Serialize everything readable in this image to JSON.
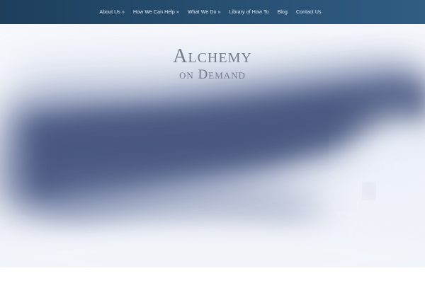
{
  "nav": {
    "items": [
      {
        "label": "About Us »"
      },
      {
        "label": "How We Can Help »"
      },
      {
        "label": "What We Do »"
      },
      {
        "label": "Library of How To"
      },
      {
        "label": "Blog"
      },
      {
        "label": "Contact Us"
      }
    ]
  },
  "hero": {
    "brand_line1": "Alchemy",
    "brand_line2": "on Demand"
  },
  "colors": {
    "nav_background": "#244a6b",
    "nav_text": "#e8eef5",
    "cloud_dark": "#3f4f78",
    "sky_light": "#f4f6fb",
    "brand_text": "#6d7487"
  }
}
